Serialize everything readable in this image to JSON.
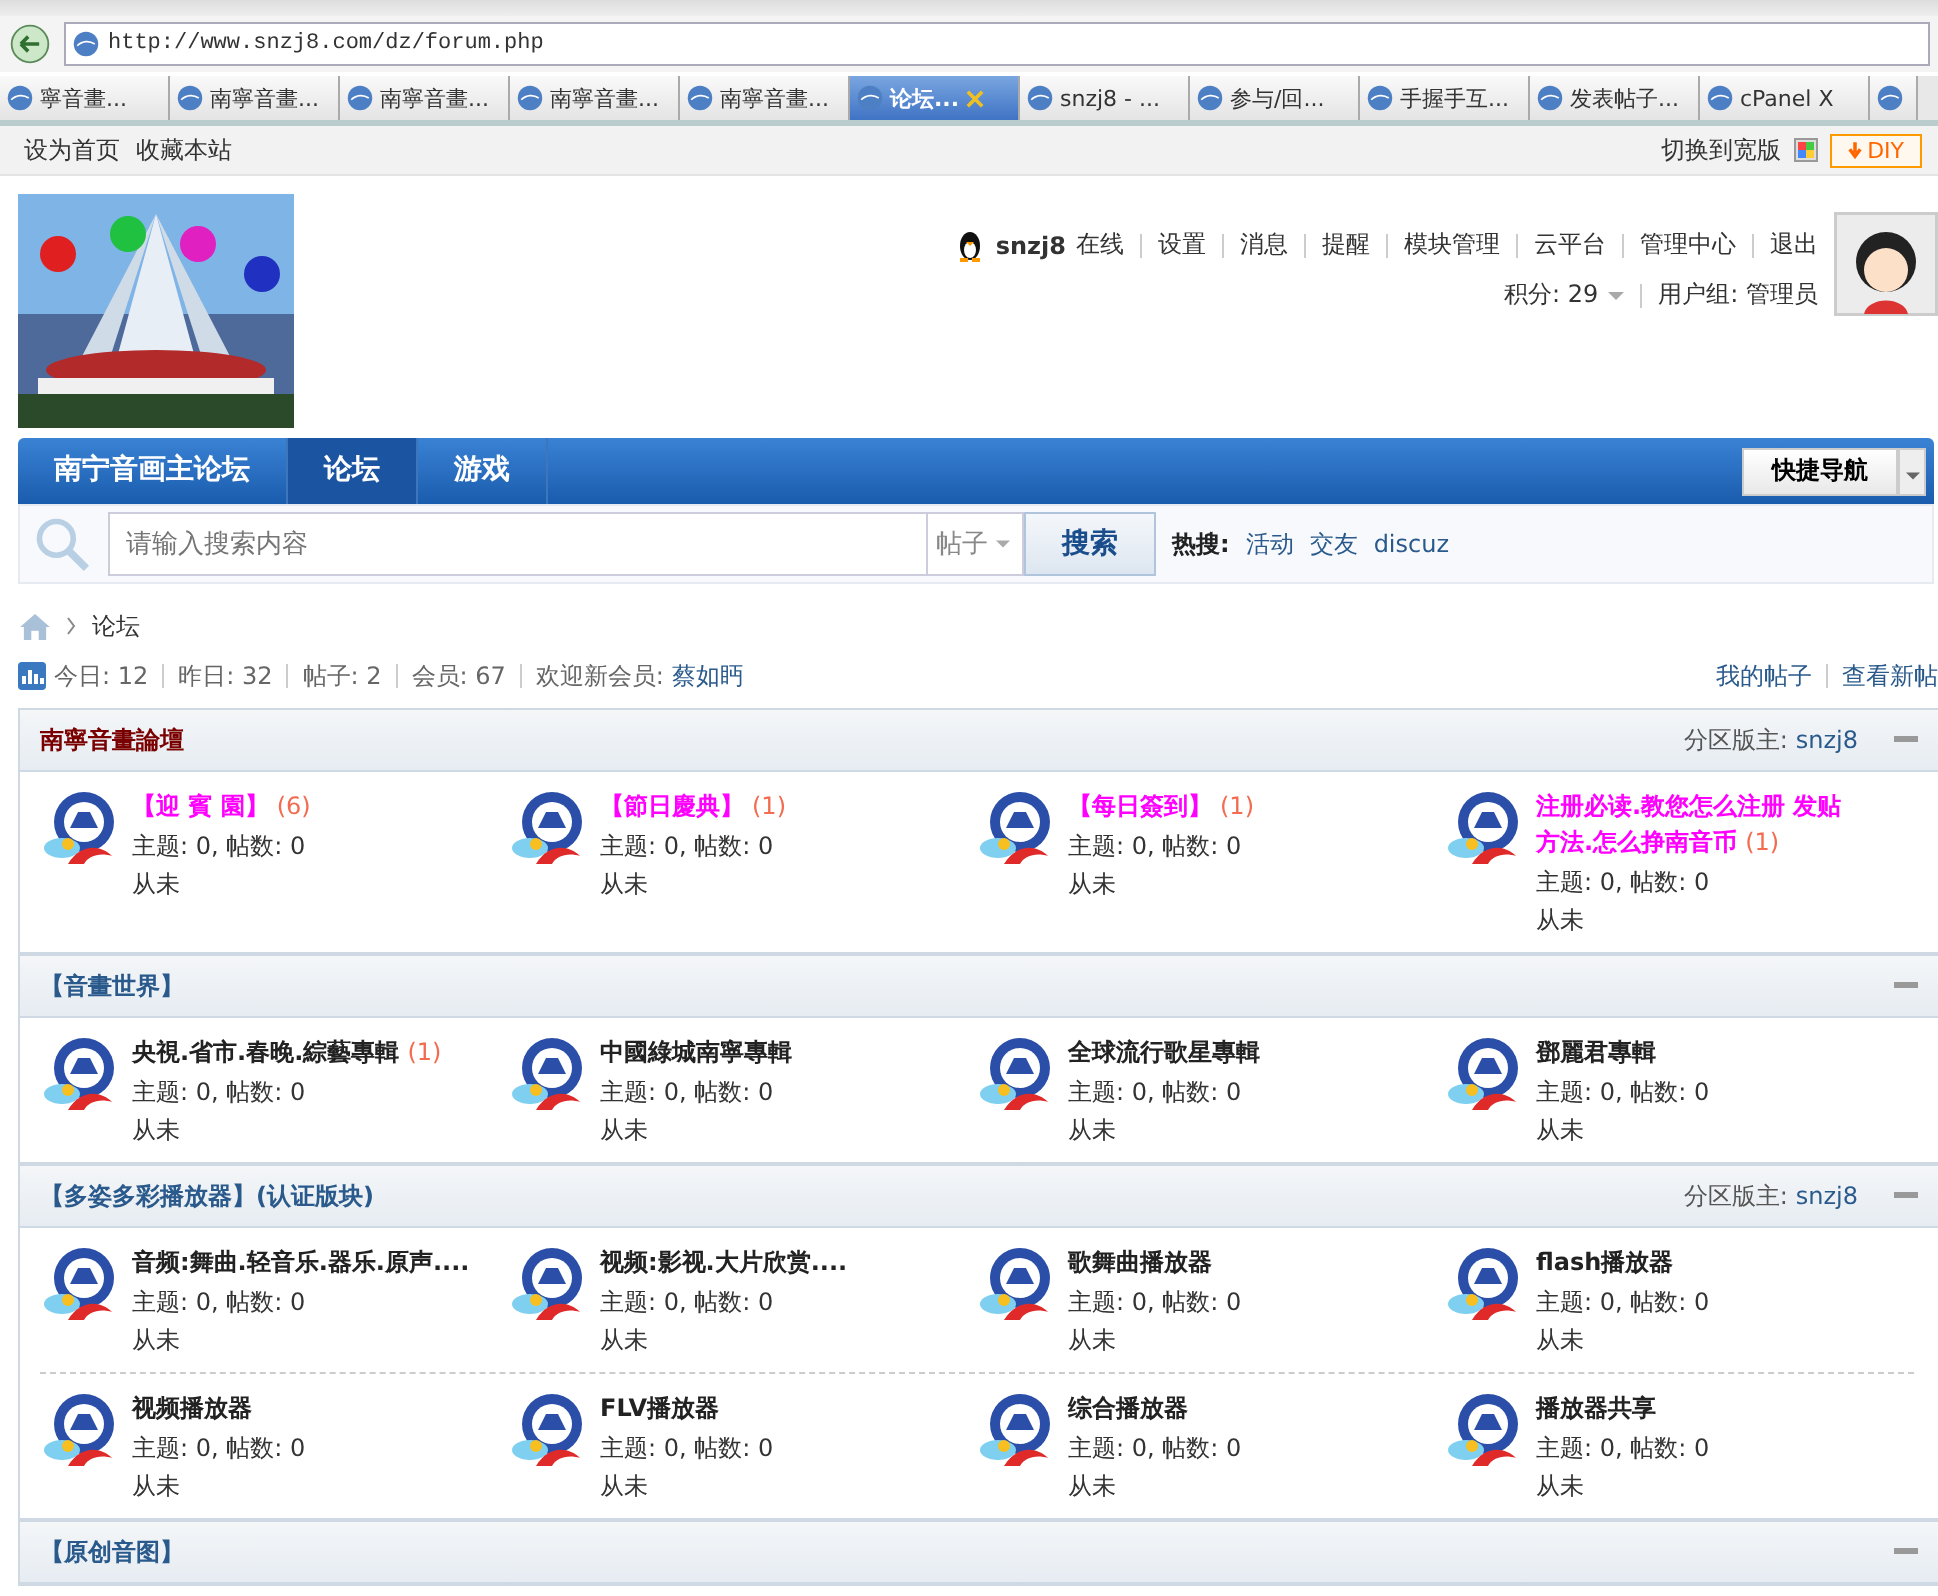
{
  "browser": {
    "address": "http://www.snzj8.com/dz/forum.php",
    "tabs": [
      {
        "label": "寧音畫...",
        "selected": false
      },
      {
        "label": "南寧音畫...",
        "selected": false
      },
      {
        "label": "南寧音畫...",
        "selected": false
      },
      {
        "label": "南寧音畫...",
        "selected": false
      },
      {
        "label": "南寧音畫...",
        "selected": false
      },
      {
        "label": "论坛...",
        "selected": true
      },
      {
        "label": "snzj8 - ...",
        "selected": false
      },
      {
        "label": "参与/回...",
        "selected": false
      },
      {
        "label": "手握手互...",
        "selected": false
      },
      {
        "label": "发表帖子...",
        "selected": false
      },
      {
        "label": "cPanel X",
        "selected": false
      }
    ]
  },
  "topbar": {
    "left": [
      "设为首页",
      "收藏本站"
    ],
    "switch": "切换到宽版",
    "diy": "DIY"
  },
  "user": {
    "name": "snzj8",
    "status": "在线",
    "links": [
      "设置",
      "消息",
      "提醒",
      "模块管理",
      "云平台",
      "管理中心",
      "退出"
    ],
    "credits": "积分: 29",
    "group": "用户组: 管理员"
  },
  "nav": {
    "items": [
      {
        "label": "南宁音画主论坛",
        "selected": false
      },
      {
        "label": "论坛",
        "selected": true
      },
      {
        "label": "游戏",
        "selected": false
      }
    ],
    "quick": "快捷导航"
  },
  "search": {
    "placeholder": "请输入搜索内容",
    "type": "帖子",
    "button": "搜索",
    "hot_label": "热搜:",
    "hot": [
      "活动",
      "交友",
      "discuz"
    ]
  },
  "breadcrumb": "论坛",
  "stats": {
    "items": [
      "今日: 12",
      "昨日: 32",
      "帖子: 2",
      "会员: 67"
    ],
    "welcome": "欢迎新会员:",
    "newest": "蔡如眄",
    "links": [
      "我的帖子",
      "查看新帖"
    ]
  },
  "sections": [
    {
      "title": "南寧音畫論壇",
      "color": "#7a0000",
      "moderator_label": "分区版主:",
      "moderator": "snzj8",
      "rows": [
        [
          {
            "name": "【迎 賓 園】",
            "count": "(6)",
            "color": "#ff00ff",
            "stats": "主题: 0, 帖数: 0",
            "last": "从未"
          },
          {
            "name": "【節日慶典】",
            "count": "(1)",
            "color": "#ff00ff",
            "stats": "主题: 0, 帖数: 0",
            "last": "从未"
          },
          {
            "name": "【每日簽到】",
            "count": "(1)",
            "color": "#ff00ff",
            "stats": "主题: 0, 帖数: 0",
            "last": "从未"
          },
          {
            "name": "注册必读.教您怎么注册 发贴方法.怎么挣南音币",
            "count": "(1)",
            "color": "#ff00ff",
            "stats": "主题: 0, 帖数: 0",
            "last": "从未"
          }
        ]
      ]
    },
    {
      "title": "【音畫世界】",
      "color": "#2a5a8c",
      "rows": [
        [
          {
            "name": "央視.省市.春晚.綜藝專輯",
            "count": "(1)",
            "color": "#222222",
            "stats": "主题: 0, 帖数: 0",
            "last": "从未"
          },
          {
            "name": "中國綠城南寧專輯",
            "color": "#222222",
            "stats": "主题: 0, 帖数: 0",
            "last": "从未"
          },
          {
            "name": "全球流行歌星專輯",
            "color": "#222222",
            "stats": "主题: 0, 帖数: 0",
            "last": "从未"
          },
          {
            "name": "鄧麗君專輯",
            "color": "#222222",
            "stats": "主题: 0, 帖数: 0",
            "last": "从未"
          }
        ]
      ]
    },
    {
      "title": "【多姿多彩播放器】(认证版块)",
      "color": "#2a5a8c",
      "moderator_label": "分区版主:",
      "moderator": "snzj8",
      "rows": [
        [
          {
            "name": "音频:舞曲.轻音乐.器乐.原声....",
            "color": "#222222",
            "stats": "主题: 0, 帖数: 0",
            "last": "从未"
          },
          {
            "name": "视频:影视.大片欣赏....",
            "color": "#222222",
            "stats": "主题: 0, 帖数: 0",
            "last": "从未"
          },
          {
            "name": "歌舞曲播放器",
            "color": "#222222",
            "stats": "主题: 0, 帖数: 0",
            "last": "从未"
          },
          {
            "name": "flash播放器",
            "color": "#222222",
            "stats": "主题: 0, 帖数: 0",
            "last": "从未"
          }
        ],
        [
          {
            "name": "视频播放器",
            "color": "#222222",
            "stats": "主题: 0, 帖数: 0",
            "last": "从未"
          },
          {
            "name": "FLV播放器",
            "color": "#222222",
            "stats": "主题: 0, 帖数: 0",
            "last": "从未"
          },
          {
            "name": "综合播放器",
            "color": "#222222",
            "stats": "主题: 0, 帖数: 0",
            "last": "从未"
          },
          {
            "name": "播放器共享",
            "color": "#222222",
            "stats": "主题: 0, 帖数: 0",
            "last": "从未"
          }
        ]
      ]
    },
    {
      "title": "【原创音图】",
      "color": "#2a5a8c"
    }
  ]
}
